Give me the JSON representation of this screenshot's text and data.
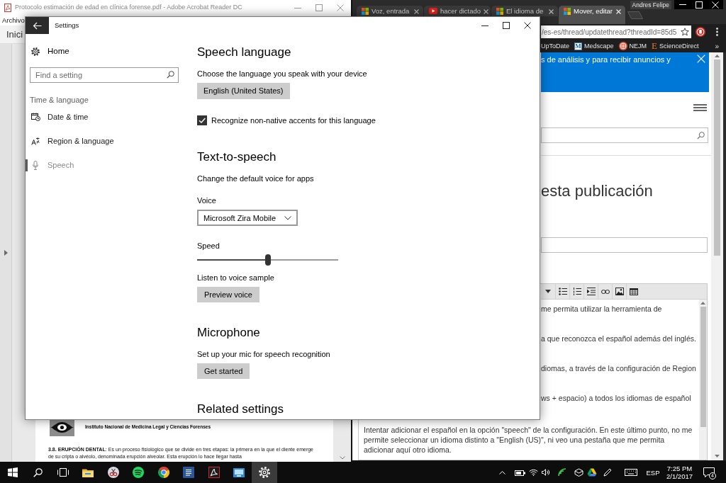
{
  "acrobat": {
    "title": "Protocolo estimación de edad en clínica forense.pdf - Adobe Acrobat Reader DC",
    "menu": [
      "Archivo"
    ],
    "tab": "Inici",
    "page": {
      "institution": "Instituto Nacional de Medicina Legal y Ciencias Forenses",
      "paragraph": "**3.8. ERUPCIÓN DENTAL**: Es un proceso fisiológico que se divide en tres etapas: la primera en la que el diente emerge de su cripta o alvéolo, denominada erupción alveolar. Esta erupción lo hace llegar hasta"
    }
  },
  "browser": {
    "profile": "Andres Felipe",
    "tabs": [
      {
        "title": "Voz, entrada",
        "kind": "squares",
        "selected": false
      },
      {
        "title": "hacer dictado",
        "kind": "play",
        "selected": false
      },
      {
        "title": "El idioma de",
        "kind": "squares",
        "selected": false
      },
      {
        "title": "Mover, editar",
        "kind": "squares",
        "selected": true
      }
    ],
    "address": "/es-es/thread/updatethread?threadId=85d5",
    "bookmarks": [
      {
        "label": "UpToDate",
        "kind": "plain"
      },
      {
        "label": "Medscape",
        "kind": "letter",
        "badge": "M"
      },
      {
        "label": "NEJM",
        "kind": "emblem"
      },
      {
        "label": "ScienceDirect",
        "kind": "serif",
        "badge": "E"
      }
    ],
    "more_bookmarks": "»",
    "banner": "s de análisis y para recibir anuncios y",
    "heading": "esta publicación",
    "editor_lines": [
      "me permita utilizar la herramienta de",
      "a que reconozca el español además del inglés.",
      "diomas, a través de la configuración de Region",
      "ws + espacio) a todos los idiomas de español"
    ],
    "editor_paragraph": "Intentar adicionar el español en la opción \"speech\" de la configuración. En este último punto, no me permite seleccionar un idioma distinto a \"English (US)\", ni veo una pestaña que me permita adicionar aquí otro idioma."
  },
  "settings": {
    "title": "Settings",
    "home": "Home",
    "search_placeholder": "Find a setting",
    "group": "Time & language",
    "nav": [
      {
        "label": "Date & time",
        "kind": "clock",
        "selected": false
      },
      {
        "label": "Region & language",
        "kind": "language",
        "selected": false
      },
      {
        "label": "Speech",
        "kind": "mic",
        "selected": true
      }
    ],
    "content": [
      {
        "kind": "heading",
        "text": "Speech language"
      },
      {
        "kind": "text",
        "text": "Choose the language you speak with your device"
      },
      {
        "kind": "dropdown",
        "value": "English (United States)",
        "disabled": true
      },
      {
        "kind": "checkbox",
        "label": "Recognize non-native accents for this language",
        "checked": true
      },
      {
        "kind": "heading",
        "text": "Text-to-speech"
      },
      {
        "kind": "text",
        "text": "Change the default voice for apps"
      },
      {
        "kind": "label",
        "text": "Voice"
      },
      {
        "kind": "dropdown",
        "value": "Microsoft Zira Mobile",
        "disabled": false
      },
      {
        "kind": "label",
        "text": "Speed"
      },
      {
        "kind": "slider",
        "level": 0.5
      },
      {
        "kind": "label",
        "text": "Listen to voice sample"
      },
      {
        "kind": "button",
        "text": "Preview voice"
      },
      {
        "kind": "heading",
        "text": "Microphone"
      },
      {
        "kind": "text",
        "text": "Set up your mic for speech recognition"
      },
      {
        "kind": "button",
        "text": "Get started"
      },
      {
        "kind": "heading",
        "text": "Related settings"
      }
    ]
  },
  "taskbar": {
    "apps": [
      {
        "kind": "start",
        "selected": false
      },
      {
        "kind": "search",
        "selected": false
      },
      {
        "kind": "task-view",
        "selected": false
      },
      {
        "kind": "folder",
        "selected": false
      },
      {
        "kind": "scissors",
        "selected": false
      },
      {
        "kind": "waves",
        "selected": false
      },
      {
        "kind": "segmented-circle",
        "selected": false
      },
      {
        "kind": "document-tile",
        "selected": false
      },
      {
        "kind": "swoosh-tile",
        "selected": false
      },
      {
        "kind": "window-tile",
        "selected": false
      },
      {
        "kind": "gear",
        "selected": true
      }
    ],
    "language": "ESP",
    "time": "7:25 PM",
    "date": "2/1/2017",
    "notifications": "4"
  }
}
